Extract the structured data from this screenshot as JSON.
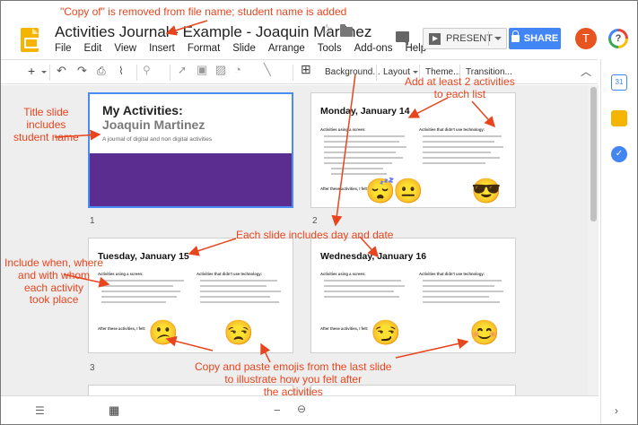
{
  "header": {
    "doc_title": "Activities Journal - Example - Joaquin Martinez",
    "menu": [
      "File",
      "Edit",
      "View",
      "Insert",
      "Format",
      "Slide",
      "Arrange",
      "Tools",
      "Add-ons",
      "Help"
    ],
    "present_label": "PRESENT",
    "share_label": "SHARE",
    "avatar_initial": "T",
    "help_glyph": "?"
  },
  "toolbar": {
    "background_label": "Background...",
    "layout_label": "Layout",
    "theme_label": "Theme...",
    "transition_label": "Transition..."
  },
  "sidebar": {
    "calendar_label": "31"
  },
  "slides": {
    "s1": {
      "number": "1",
      "title": "My Activities:",
      "name": "Joaquin Martinez",
      "subtitle": "A journal of digital and non digital activities"
    },
    "s2": {
      "number": "2",
      "title": "Monday, January 14",
      "col1": "Activities using a screen:",
      "col2": "Activities that didn't use technology:",
      "after": "After these activities, I felt:",
      "emojis": [
        "😴",
        "😐",
        "😎"
      ]
    },
    "s3": {
      "number": "3",
      "title": "Tuesday, January 15",
      "col1": "Activities using a screen:",
      "col2": "Activities that didn't use technology:",
      "after": "After these activities, I felt:",
      "emojis": [
        "😕",
        "😒"
      ]
    },
    "s4": {
      "title": "Wednesday, January 16",
      "col1": "Activities using a screen:",
      "col2": "Activities that didn't use technology:",
      "after": "After these activities, I felt:",
      "emojis": [
        "😏",
        "😊"
      ]
    }
  },
  "annotations": {
    "file_name": "\"Copy of\" is removed from file name; student name is added",
    "title_slide": "Title slide\nincludes\nstudent name",
    "two_activities": "Add at least 2 activities\nto each list",
    "day_date": "Each slide includes day and date",
    "when_where": "Include when, where\nand with whom\neach activity\ntook place",
    "emojis": "Copy and paste emojis from the last slide\nto illustrate how you felt after\nthe activities"
  },
  "colors": {
    "accent_blue": "#4285f4",
    "annotation_orange": "#e8451e",
    "title_band_purple": "#5c2d91",
    "avatar_orange": "#e8541f"
  }
}
